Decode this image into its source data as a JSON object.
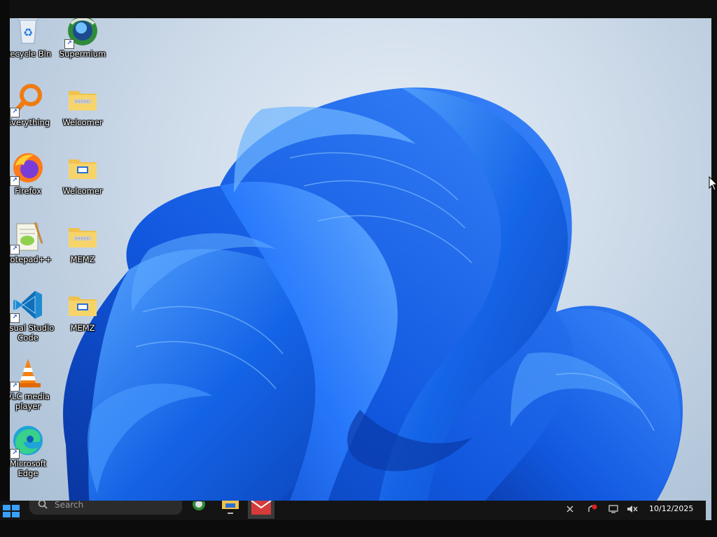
{
  "desktop": {
    "icons": [
      {
        "label": "Recycle Bin",
        "icon": "recycle-bin-icon"
      },
      {
        "label": "Supermium",
        "icon": "supermium-browser-icon"
      },
      {
        "label": "Everything",
        "icon": "everything-search-icon"
      },
      {
        "label": "Welcomer",
        "icon": "zip-folder-icon"
      },
      {
        "label": "Firefox",
        "icon": "firefox-icon"
      },
      {
        "label": "Welcomer",
        "icon": "folder-icon"
      },
      {
        "label": "Notepad++",
        "icon": "notepad-plus-plus-icon"
      },
      {
        "label": "MEMZ",
        "icon": "zip-folder-icon"
      },
      {
        "label": "Visual Studio Code",
        "icon": "vscode-icon"
      },
      {
        "label": "MEMZ",
        "icon": "folder-icon"
      },
      {
        "label": "VLC media player",
        "icon": "vlc-icon"
      },
      {
        "label": "Microsoft Edge",
        "icon": "edge-icon"
      }
    ]
  },
  "taskbar": {
    "search_placeholder": "Search",
    "clock_date": "10/12/2025",
    "apps": [
      "supermium-browser-icon",
      "file-explorer-icon",
      "mail-app-icon"
    ],
    "tray": [
      "network-icon",
      "notification-icon",
      "display-icon",
      "volume-muted-icon"
    ]
  },
  "colors": {
    "bloom_blue": "#1565e8",
    "bloom_dark": "#0a3fb3",
    "bloom_light": "#4a9bff",
    "wallpaper_bg": "#cfdcea",
    "taskbar_bg": "#141414"
  }
}
